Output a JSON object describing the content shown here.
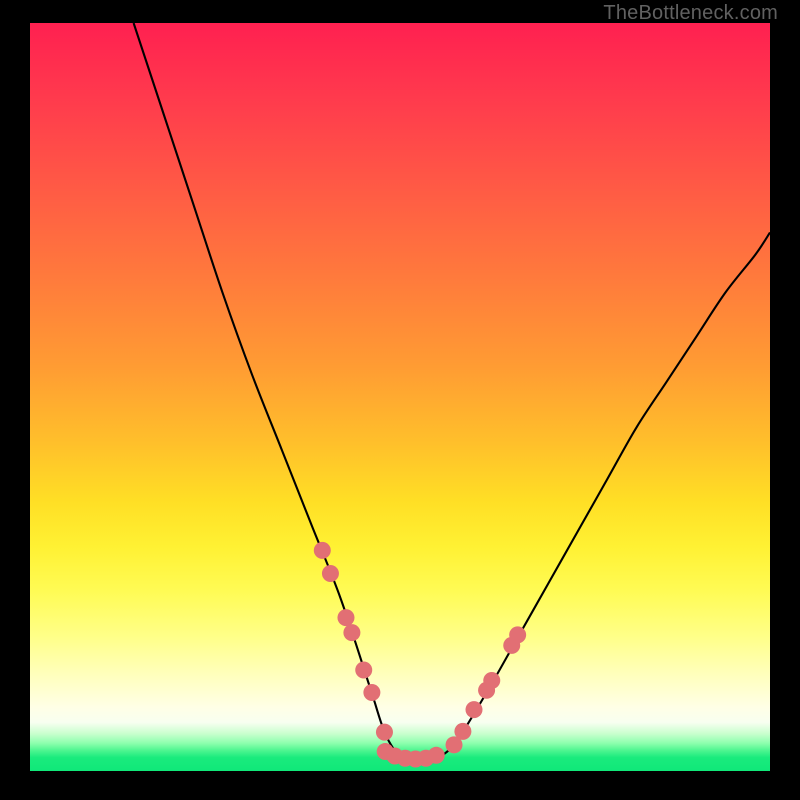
{
  "watermark": "TheBottleneck.com",
  "colors": {
    "gradient_top": "#ff2050",
    "gradient_mid1": "#ff9c33",
    "gradient_mid2": "#fff133",
    "gradient_bottom": "#10e879",
    "curve": "#000000",
    "markers": "#e26f74",
    "frame": "#000000",
    "watermark_text": "#616161"
  },
  "chart_data": {
    "type": "line",
    "title": "",
    "xlabel": "",
    "ylabel": "",
    "xlim": [
      0,
      100
    ],
    "ylim": [
      0,
      100
    ],
    "note": "Axes unlabeled in source; x/y are normalized 0–100. y = bottleneck % (0 = bottom green, 100 = top red). V-shaped curve with flat trough near x≈48–55.",
    "series": [
      {
        "name": "bottleneck-curve",
        "x": [
          14,
          18,
          22,
          26,
          30,
          34,
          38,
          42,
          46,
          48,
          50,
          52,
          54,
          56,
          58,
          62,
          66,
          70,
          74,
          78,
          82,
          86,
          90,
          94,
          98,
          100
        ],
        "y": [
          100,
          88,
          76,
          64,
          53,
          43,
          33,
          23,
          11,
          5,
          2,
          1.6,
          1.6,
          2.3,
          4.5,
          11,
          18,
          25,
          32,
          39,
          46,
          52,
          58,
          64,
          69,
          72
        ]
      }
    ],
    "markers": {
      "name": "curve-dots",
      "note": "Salmon dots clustered on left arm near x≈39–48 and right arm near x≈56–65, plus across trough x≈48–55.",
      "points": [
        {
          "x": 39.5,
          "y": 29.5
        },
        {
          "x": 40.6,
          "y": 26.4
        },
        {
          "x": 42.7,
          "y": 20.5
        },
        {
          "x": 43.5,
          "y": 18.5
        },
        {
          "x": 45.1,
          "y": 13.5
        },
        {
          "x": 46.2,
          "y": 10.5
        },
        {
          "x": 47.9,
          "y": 5.2
        },
        {
          "x": 48.0,
          "y": 2.6
        },
        {
          "x": 49.3,
          "y": 2.0
        },
        {
          "x": 50.7,
          "y": 1.7
        },
        {
          "x": 52.1,
          "y": 1.6
        },
        {
          "x": 53.5,
          "y": 1.7
        },
        {
          "x": 54.9,
          "y": 2.1
        },
        {
          "x": 57.3,
          "y": 3.5
        },
        {
          "x": 58.5,
          "y": 5.3
        },
        {
          "x": 60.0,
          "y": 8.2
        },
        {
          "x": 61.7,
          "y": 10.8
        },
        {
          "x": 62.4,
          "y": 12.1
        },
        {
          "x": 65.1,
          "y": 16.8
        },
        {
          "x": 65.9,
          "y": 18.2
        }
      ]
    }
  }
}
